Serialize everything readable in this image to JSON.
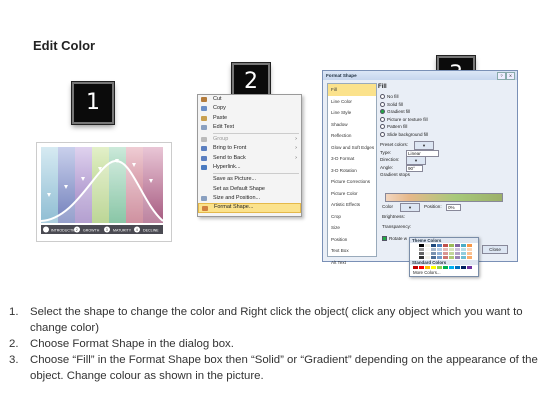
{
  "title": "Edit Color",
  "badges": [
    "1",
    "2",
    "3"
  ],
  "panel1": {
    "labels": [
      "INTRODUCTION",
      "2",
      "GROWTH",
      "3",
      "MATURITY",
      "4",
      "DECLINE"
    ],
    "colors": [
      "#9dc4d8",
      "#7f8ec2",
      "#a88fc6",
      "#b9d58a",
      "#79c39f",
      "#c97f8f",
      "#b57090"
    ]
  },
  "menu": {
    "items": [
      {
        "label": "Cut",
        "icon": "scissors-icon",
        "color": "#b47c3c"
      },
      {
        "label": "Copy",
        "icon": "copy-icon",
        "color": "#6b8fc8"
      },
      {
        "label": "Paste",
        "icon": "paste-icon",
        "color": "#c8a050"
      },
      {
        "label": "Edit Text",
        "icon": "edit-text-icon",
        "color": "#8aa0c0"
      },
      {
        "label": "Group",
        "icon": "group-icon",
        "color": "#bbbbbb",
        "submenu": true,
        "disabled": true
      },
      {
        "label": "Bring to Front",
        "icon": "bring-front-icon",
        "color": "#5b7fc0",
        "submenu": true
      },
      {
        "label": "Send to Back",
        "icon": "send-back-icon",
        "color": "#5b7fc0",
        "submenu": true
      },
      {
        "label": "Hyperlink...",
        "icon": "hyperlink-icon",
        "color": "#4a7ac0"
      },
      {
        "label": "Save as Picture...",
        "icon": "",
        "color": ""
      },
      {
        "label": "Set as Default Shape",
        "icon": "",
        "color": ""
      },
      {
        "label": "Size and Position...",
        "icon": "size-icon",
        "color": "#8aa0c0"
      },
      {
        "label": "Format Shape...",
        "icon": "format-shape-icon",
        "color": "#d08040",
        "highlight": true
      }
    ]
  },
  "dialog": {
    "title": "Format Shape",
    "title_buttons": [
      "?",
      "X"
    ],
    "categories": [
      "Fill",
      "Line Color",
      "Line Style",
      "Shadow",
      "Reflection",
      "Glow and Soft Edges",
      "3-D Format",
      "3-D Rotation",
      "Picture Corrections",
      "Picture Color",
      "Artistic Effects",
      "Crop",
      "Size",
      "Position",
      "Text Box",
      "Alt Text"
    ],
    "heading": "Fill",
    "options": [
      "No fill",
      "Solid fill",
      "Gradient fill",
      "Picture or texture fill",
      "Pattern fill",
      "Slide background fill"
    ],
    "selected_option": "Gradient fill",
    "preset_label": "Preset colors:",
    "type_label": "Type:",
    "type_value": "Linear",
    "direction_label": "Direction:",
    "angle_label": "Angle:",
    "angle_value": "90°",
    "stops_label": "Gradient stops",
    "color_label": "Color",
    "position_label": "Position:",
    "position_value": "0%",
    "brightness_label": "Brightness:",
    "transparency_label": "Transparency:",
    "rotate_label": "Rotate w",
    "close_label": "Close"
  },
  "popup": {
    "theme_label": "Theme Colors",
    "standard_label": "Standard Colors",
    "more_label": "More Colors...",
    "theme_colors": [
      "#ffffff",
      "#000000",
      "#eeece1",
      "#1f497d",
      "#4f81bd",
      "#c0504d",
      "#9bbb59",
      "#8064a2",
      "#4bacc6",
      "#f79646"
    ],
    "standard_colors": [
      "#c00000",
      "#ff0000",
      "#ffc000",
      "#ffff00",
      "#92d050",
      "#00b050",
      "#00b0f0",
      "#0070c0",
      "#002060",
      "#7030a0"
    ]
  },
  "steps": [
    {
      "num": "1.",
      "text": "Select the shape to change the color and Right click the object( click any object which you want to change color)"
    },
    {
      "num": "2.",
      "text": "Choose Format Shape in the dialog box."
    },
    {
      "num": "3.",
      "text": "Choose “Fill” in the Format Shape box then “Solid” or “Gradient” depending on the appearance of the object. Change colour as shown in the picture."
    }
  ]
}
